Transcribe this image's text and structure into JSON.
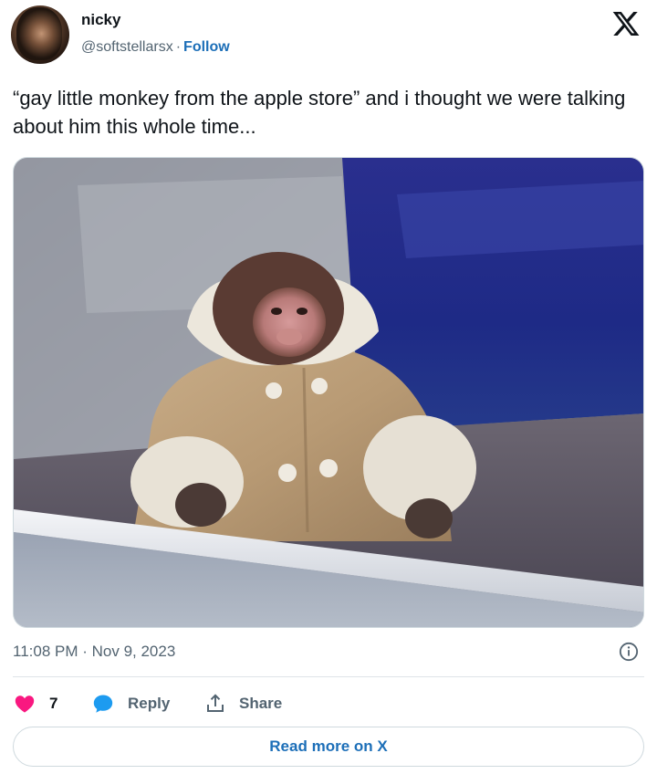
{
  "post": {
    "author_name": "nicky",
    "handle": "@softstellarsx",
    "separator": "·",
    "follow_label": "Follow",
    "text": "“gay little monkey from the apple store” and i thought we were talking about him this whole time...",
    "timestamp": "11:08 PM · Nov 9, 2023"
  },
  "actions": {
    "like_count": "7",
    "reply_label": "Reply",
    "share_label": "Share",
    "read_more_label": "Read more on X"
  },
  "icons": {
    "brand": "x-logo-icon",
    "info": "info-icon",
    "like": "heart-icon",
    "reply": "speech-bubble-icon",
    "share": "share-icon"
  },
  "colors": {
    "like": "#f91880",
    "reply": "#1d9bf0",
    "link": "#1d6fb8",
    "muted": "#536471",
    "text": "#0f1419"
  }
}
